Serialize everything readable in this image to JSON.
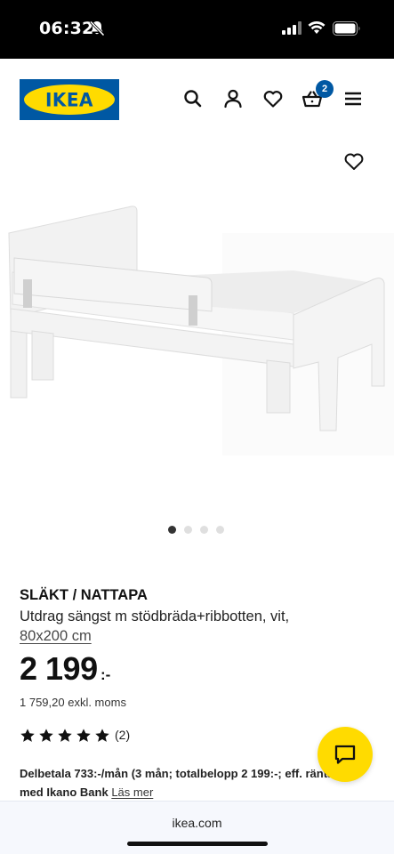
{
  "status_bar": {
    "time": "06:32",
    "icons": [
      "bell-slash-icon",
      "cellular-signal-icon",
      "wifi-icon",
      "battery-icon"
    ]
  },
  "header": {
    "logo_text": "IKEA",
    "brand_colors": {
      "blue": "#0058a3",
      "yellow": "#ffdb00"
    },
    "icons": [
      "search-icon",
      "user-icon",
      "heart-icon",
      "cart-icon",
      "menu-icon"
    ],
    "cart_count": "2"
  },
  "gallery": {
    "favorite_icon": "heart-icon",
    "image_count": 4,
    "active_index": 0
  },
  "product": {
    "name": "SLÄKT / NATTAPA",
    "description": "Utdrag sängst m stödbräda+ribbotten, vit,",
    "size": "80x200 cm",
    "price": "2 199",
    "price_suffix": ":-",
    "price_excl": "1 759,20 exkl. moms",
    "rating_stars": 5,
    "rating_count": "(2)",
    "finance_text": "Delbetala 733:-/mån (3 mån; totalbelopp 2 199:-; eff. ränta 0%) med Ikano Bank",
    "finance_link": "Läs mer"
  },
  "chat": {
    "icon": "chat-icon",
    "color": "#ffdb00"
  },
  "browser": {
    "url": "ikea.com"
  }
}
